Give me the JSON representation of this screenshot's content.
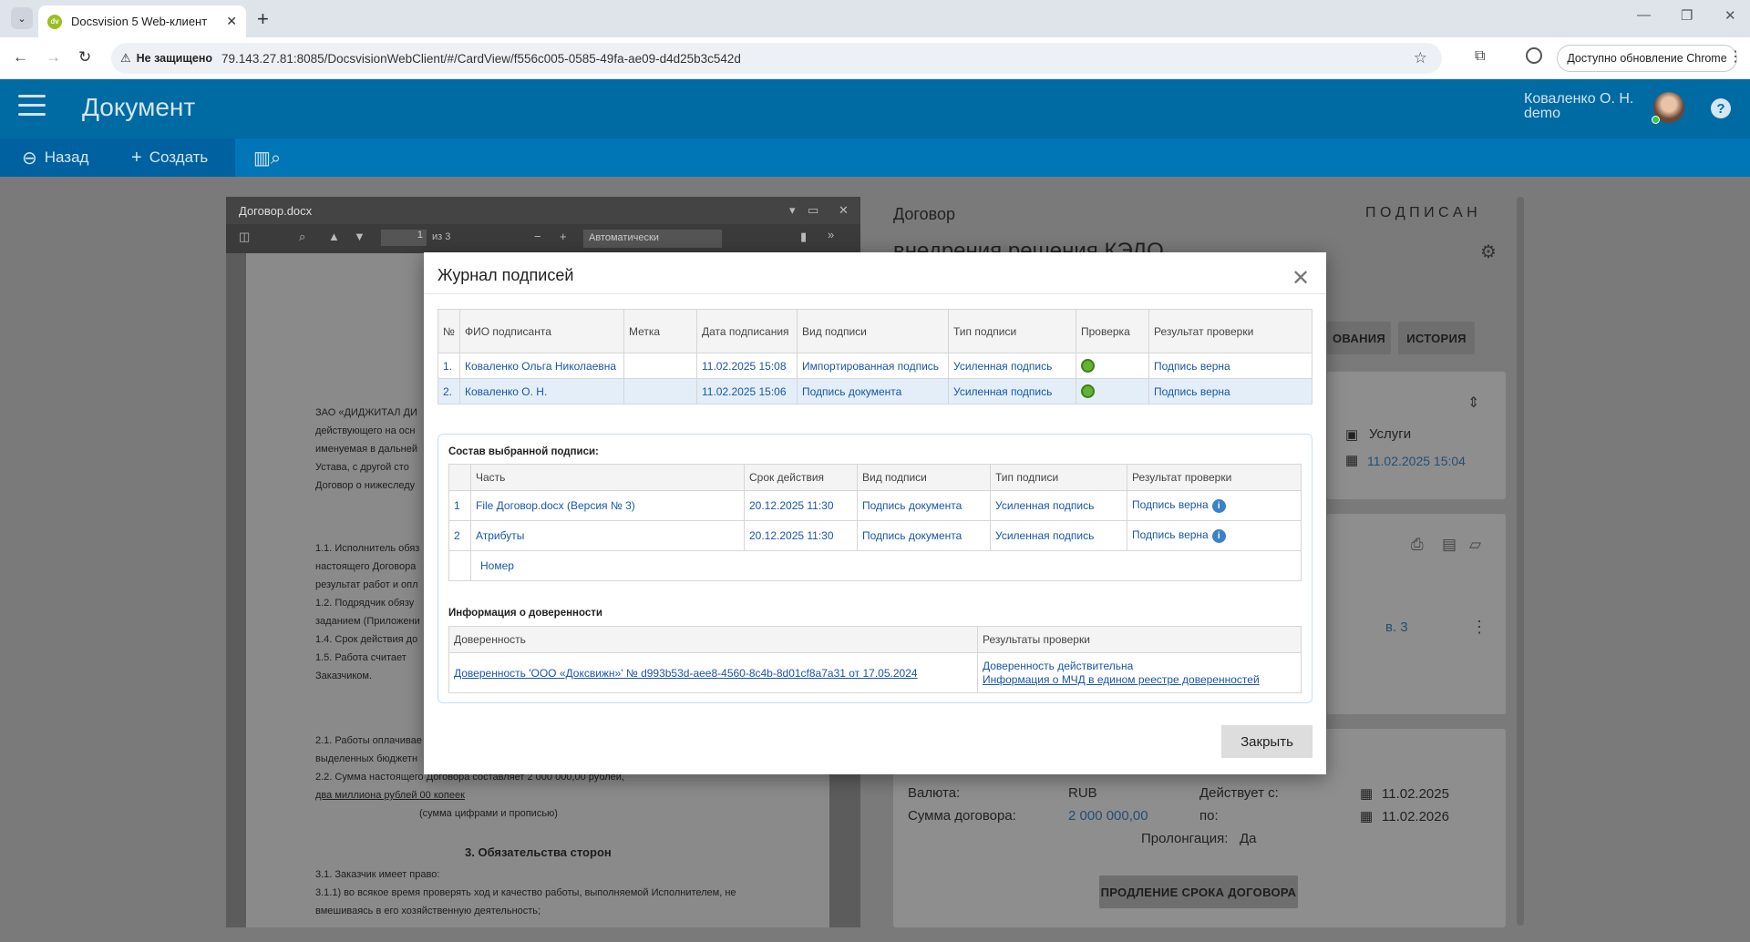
{
  "browser": {
    "tab_title": "Docsvision 5 Web-клиент",
    "favicon_text": "dv",
    "security_label": "Не защищено",
    "url": "79.143.27.81:8085/DocsvisionWebClient/#/CardView/f556c005-0585-49fa-ae09-d4d25b3c542d",
    "update_label": "Доступно обновление Chrome"
  },
  "app": {
    "title": "Документ",
    "user_name": "Коваленко О. Н.",
    "user_login": "demo",
    "help": "?"
  },
  "toolbar": {
    "back": "Назад",
    "create": "Создать"
  },
  "viewer": {
    "file_name": "Договор.docx",
    "page": "1",
    "page_of": "из 3",
    "zoom": "Автоматически",
    "lines": [
      {
        "t": "ЗАО «ДИДЖИТАЛ ДИ",
        "bold": false
      },
      {
        "t": "действующего на осн",
        "bold": false
      },
      {
        "t": "именуемая в дальней",
        "bold": false
      },
      {
        "t": "Устава, с другой сто",
        "bold": false
      },
      {
        "t": "Договор о нижеследу",
        "bold": false
      }
    ],
    "lines2": [
      "1.1. Исполнитель обяз",
      "настоящего Договора",
      "результат работ и опл",
      "1.2. Подрядчик обязу",
      "заданием (Приложени",
      "1.4. Срок действия до",
      "1.5. Работа считает",
      "Заказчиком."
    ],
    "lines3": [
      "2.1. Работы оплачивае",
      "выделенных бюджетн",
      "2.2. Сумма настоящего Договора составляет 2 000 000,00 рублей,"
    ],
    "underlined": "два миллиона рублей 00 копеек",
    "caption": "(сумма цифрами и прописью)",
    "section3": "3. Обязательства сторон",
    "p31": "3.1. Заказчик имеет право:",
    "p311": "3.1.1) во всякое время проверять ход и качество работы, выполняемой Исполнителем, не",
    "p311b": "вмешиваясь в его хозяйственную деятельность;"
  },
  "card": {
    "type": "Договор",
    "status": "П О Д П И С А Н",
    "title": "внедрения решения КЭДО",
    "btn_approval": "ОВАНИЯ",
    "btn_history": "ИСТОРИЯ",
    "services": "Услуги",
    "date_created": "11.02.2025 15:04",
    "version": "в. 3",
    "currency_label": "Валюта:",
    "currency": "RUB",
    "sum_label": "Сумма договора:",
    "sum": "2 000 000,00",
    "valid_from_label": "Действует с:",
    "valid_from": "11.02.2025",
    "valid_to_label": "по:",
    "valid_to": "11.02.2026",
    "prolong_label": "Пролонгация:",
    "prolong": "Да",
    "extend_btn": "ПРОДЛЕНИЕ СРОКА ДОГОВОРА"
  },
  "modal": {
    "title": "Журнал подписей",
    "headers": [
      "№",
      "ФИО подписанта",
      "Метка",
      "Дата подписания",
      "Вид подписи",
      "Тип подписи",
      "Проверка",
      "Результат проверки"
    ],
    "rows": [
      {
        "n": "1.",
        "name": "Коваленко Ольга Николаевна",
        "mark": "",
        "date": "11.02.2025 15:08",
        "kind": "Импортированная подпись",
        "type": "Усиленная подпись",
        "result": "Подпись верна"
      },
      {
        "n": "2.",
        "name": "Коваленко О. Н.",
        "mark": "",
        "date": "11.02.2025 15:06",
        "kind": "Подпись документа",
        "type": "Усиленная подпись",
        "result": "Подпись верна"
      }
    ],
    "composition_title": "Состав выбранной подписи:",
    "comp_headers": [
      "Часть",
      "Срок действия",
      "Вид подписи",
      "Тип подписи",
      "Результат проверки"
    ],
    "comp_rows": [
      {
        "n": "1",
        "part": "File Договор.docx (Версия № 3)",
        "valid": "20.12.2025 11:30",
        "kind": "Подпись документа",
        "type": "Усиленная подпись",
        "result": "Подпись верна"
      },
      {
        "n": "2",
        "part": "Атрибуты",
        "valid": "20.12.2025 11:30",
        "kind": "Подпись документа",
        "type": "Усиленная подпись",
        "result": "Подпись верна"
      }
    ],
    "comp_sub": "Номер",
    "poa_title": "Информация о доверенности",
    "poa_headers": [
      "Доверенность",
      "Результаты проверки"
    ],
    "poa_link": "Доверенность 'ООО «Доксвижн»' № d993b53d-aee8-4560-8c4b-8d01cf8a7a31 от 17.05.2024",
    "poa_result1": "Доверенность действительна",
    "poa_result2": "Информация о МЧД в едином реестре доверенностей",
    "close": "Закрыть"
  }
}
